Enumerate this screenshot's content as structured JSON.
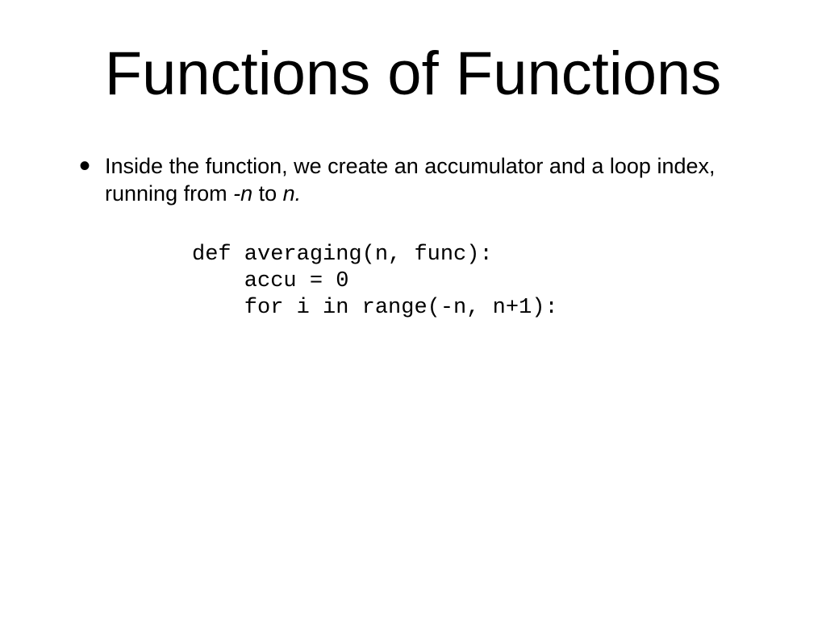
{
  "title": "Functions of Functions",
  "bullet": {
    "pre": "Inside the function, we create an accumulator and a loop index, running from ",
    "neg_n": "-n",
    "mid": " to ",
    "n": "n.",
    "post": ""
  },
  "code": "def averaging(n, func):\n    accu = 0\n    for i in range(-n, n+1):"
}
